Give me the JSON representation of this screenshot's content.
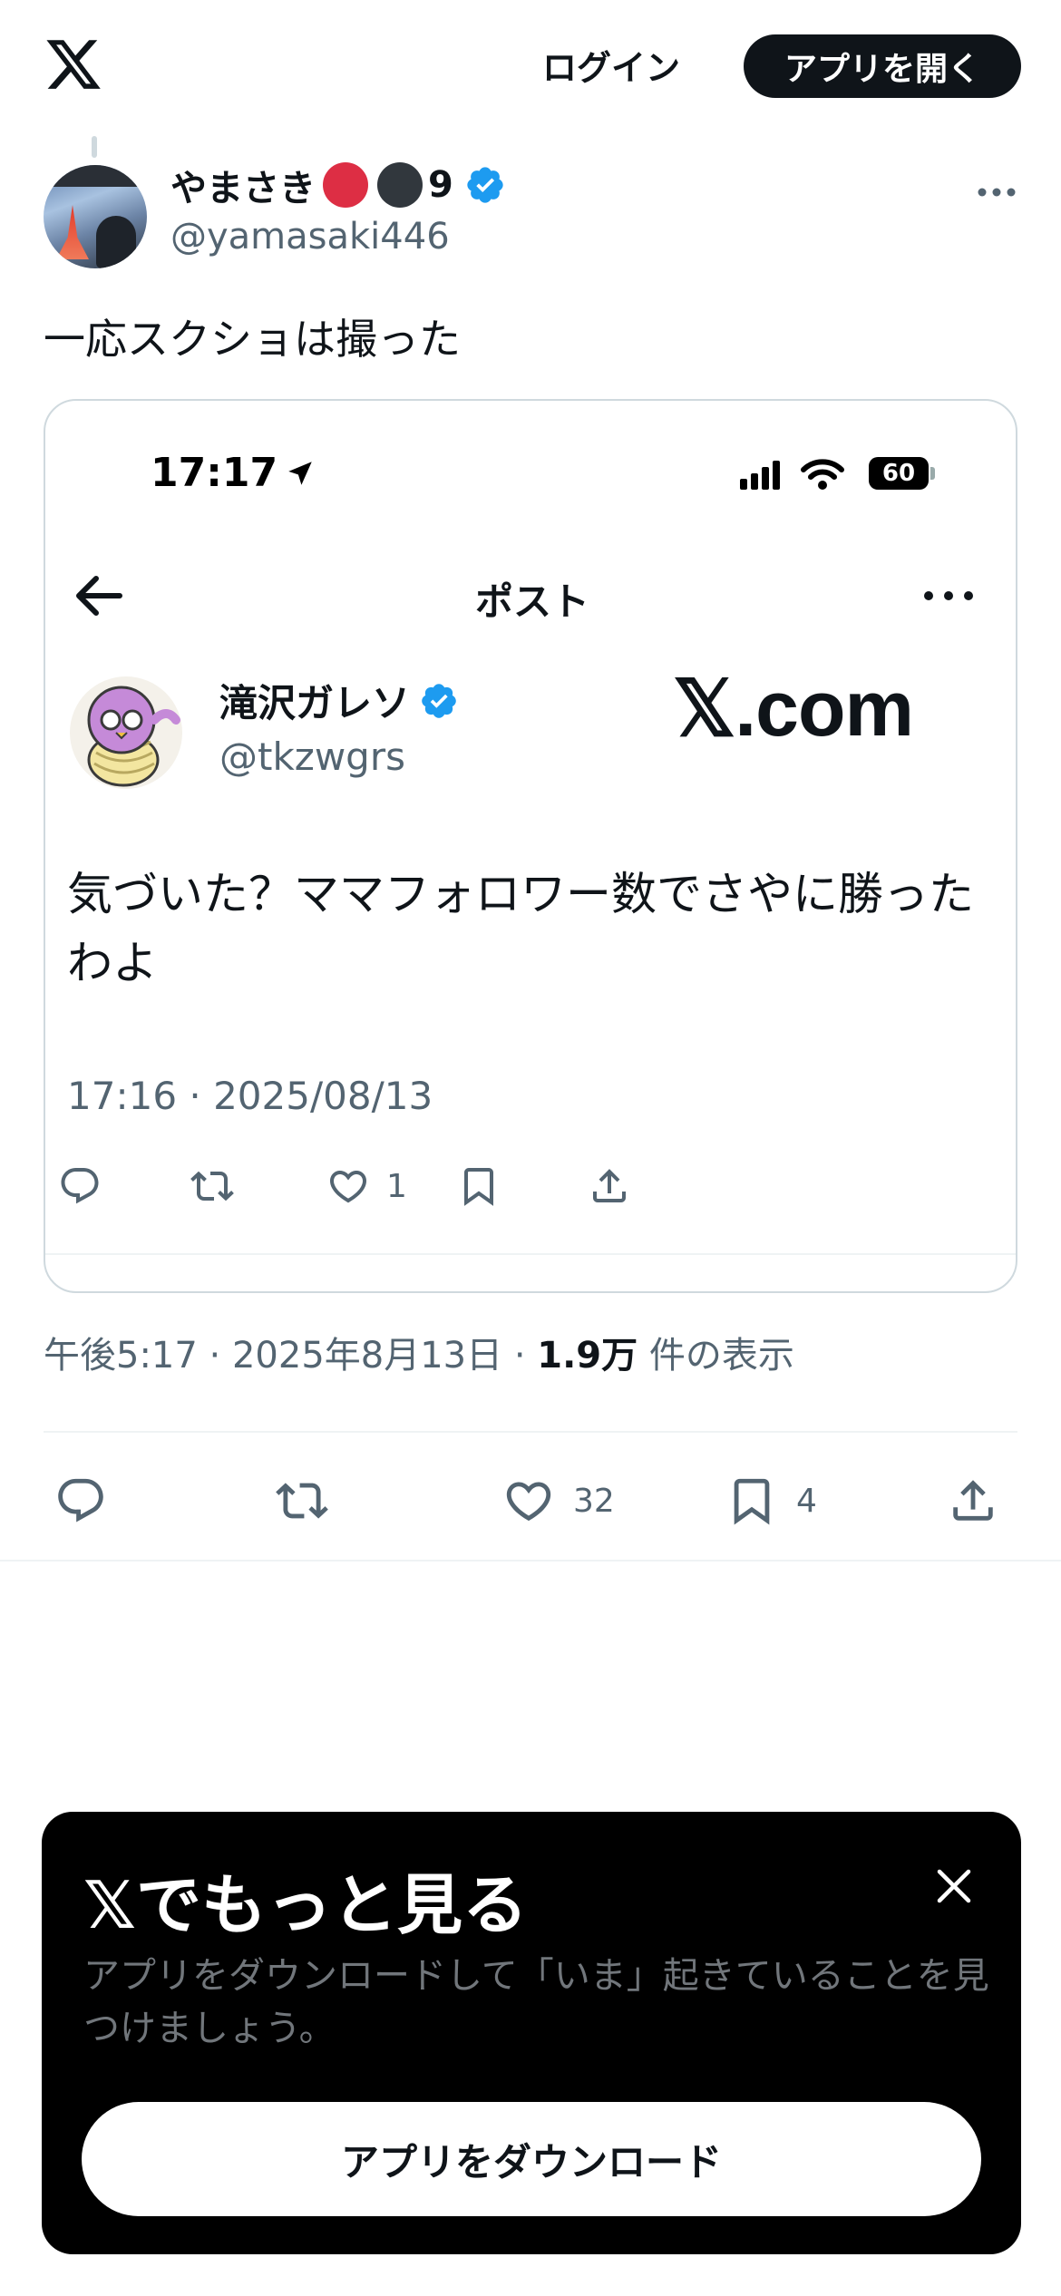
{
  "topbar": {
    "logo_icon": "x-logo-icon",
    "login_label": "ログイン",
    "open_app_label": "アプリを開く"
  },
  "post": {
    "display_name": "やまさき",
    "name_suffix": "9",
    "emoji": [
      "red-circle",
      "black-circle"
    ],
    "verified": true,
    "handle": "@yamasaki446",
    "text": "一応スクショは撮った",
    "timestamp": "午後5:17 · 2025年8月13日 · ",
    "views_count": "1.9万",
    "views_label": " 件の表示",
    "stats": {
      "likes": "32",
      "bookmarks": "4"
    }
  },
  "embedded_screenshot": {
    "status_time": "17:17",
    "battery": "60",
    "header_title": "ポスト",
    "author_name": "滝沢ガレソ",
    "author_handle": "@tkzwgrs",
    "brand": "𝕏.com",
    "text": "気づいた？ママフォロワー数でさやに勝ったわよ",
    "date": "17:16 · 2025/08/13",
    "likes": "1"
  },
  "promo": {
    "title": "𝕏でもっと見る",
    "text": "アプリをダウンロードして「いま」起きていることを見つけましょう。",
    "button_label": "アプリをダウンロード"
  },
  "colors": {
    "text_primary": "#0f1419",
    "text_secondary": "#536471",
    "verified_blue": "#1d9bf0",
    "border": "#cfd9de"
  }
}
